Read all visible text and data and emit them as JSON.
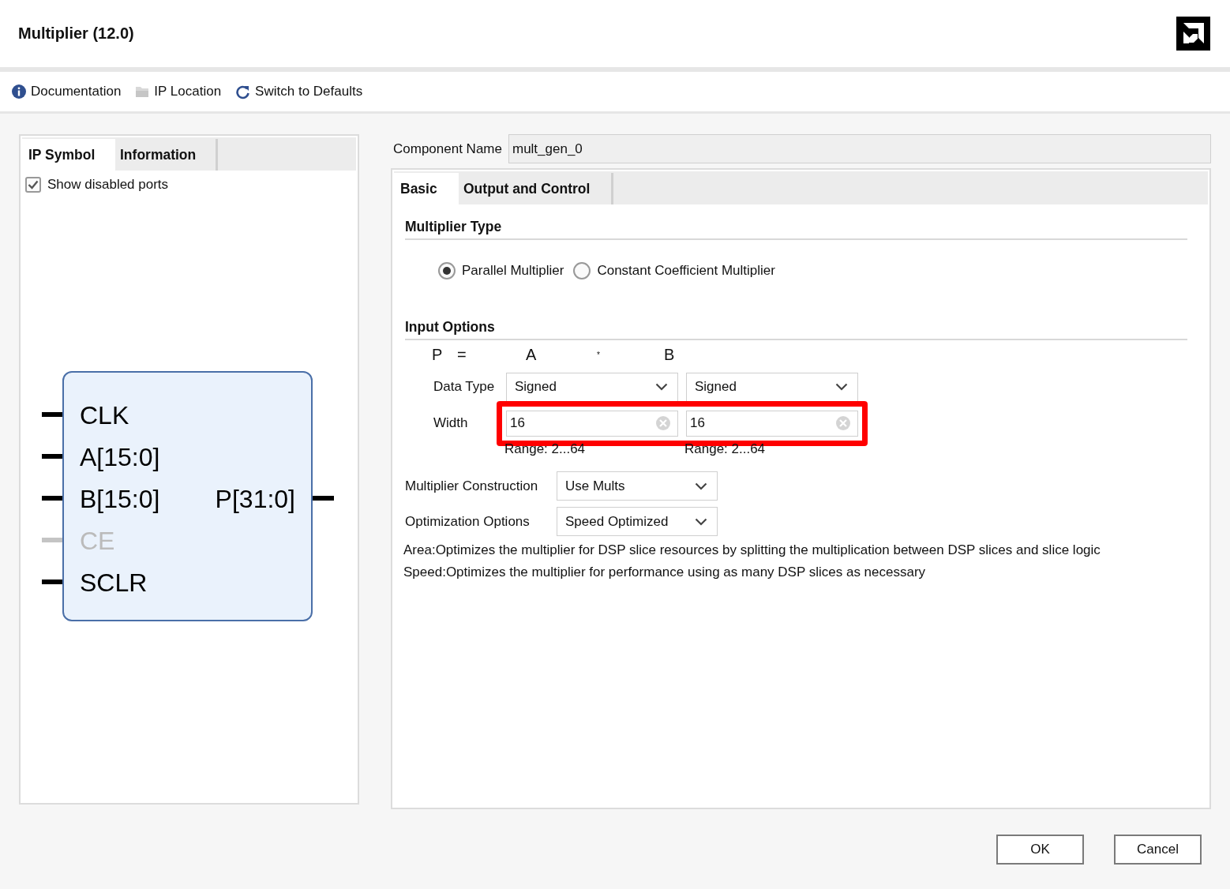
{
  "window": {
    "title": "Multiplier (12.0)"
  },
  "toolbar": [
    {
      "kind": "info",
      "label": "Documentation"
    },
    {
      "kind": "folder",
      "label": "IP Location"
    },
    {
      "kind": "refresh",
      "label": "Switch to Defaults"
    }
  ],
  "left_tabs": [
    {
      "label": "IP Symbol",
      "selected": true
    },
    {
      "label": "Information",
      "selected": false
    }
  ],
  "show_disabled_ports": {
    "label": "Show disabled ports",
    "checked": true
  },
  "symbol": {
    "rows": [
      {
        "left": {
          "name": "CLK",
          "disabled": false
        }
      },
      {
        "left": {
          "name": "A[15:0]",
          "disabled": false
        }
      },
      {
        "left": {
          "name": "B[15:0]",
          "disabled": false
        },
        "right": {
          "name": "P[31:0]",
          "disabled": false
        }
      },
      {
        "left": {
          "name": "CE",
          "disabled": true
        }
      },
      {
        "left": {
          "name": "SCLR",
          "disabled": false
        }
      }
    ]
  },
  "component_name": {
    "label": "Component Name",
    "value": "mult_gen_0"
  },
  "tabs": [
    {
      "label": "Basic",
      "selected": true
    },
    {
      "label": "Output and Control",
      "selected": false
    }
  ],
  "multiplier_type": {
    "title": "Multiplier Type",
    "options": [
      {
        "label": "Parallel Multiplier",
        "selected": true
      },
      {
        "label": "Constant Coefficient Multiplier",
        "selected": false
      }
    ]
  },
  "input_options": {
    "title": "Input Options",
    "equation": [
      "P",
      "=",
      "A",
      "*",
      "B"
    ],
    "data_type": {
      "label": "Data Type",
      "values": [
        "Signed",
        "Signed"
      ]
    },
    "width": {
      "label": "Width",
      "values": [
        "16",
        "16"
      ],
      "highlighted": true
    },
    "ranges": [
      "Range: 2...64",
      "Range: 2...64"
    ]
  },
  "construction": {
    "label": "Multiplier Construction",
    "value": "Use Mults"
  },
  "optimization": {
    "label": "Optimization Options",
    "value": "Speed Optimized"
  },
  "notes": [
    "Area:Optimizes the multiplier for DSP slice resources by splitting the multiplication between DSP slices and slice logic",
    "Speed:Optimizes the multiplier for performance using as many DSP slices as necessary"
  ],
  "buttons": [
    "OK",
    "Cancel"
  ]
}
